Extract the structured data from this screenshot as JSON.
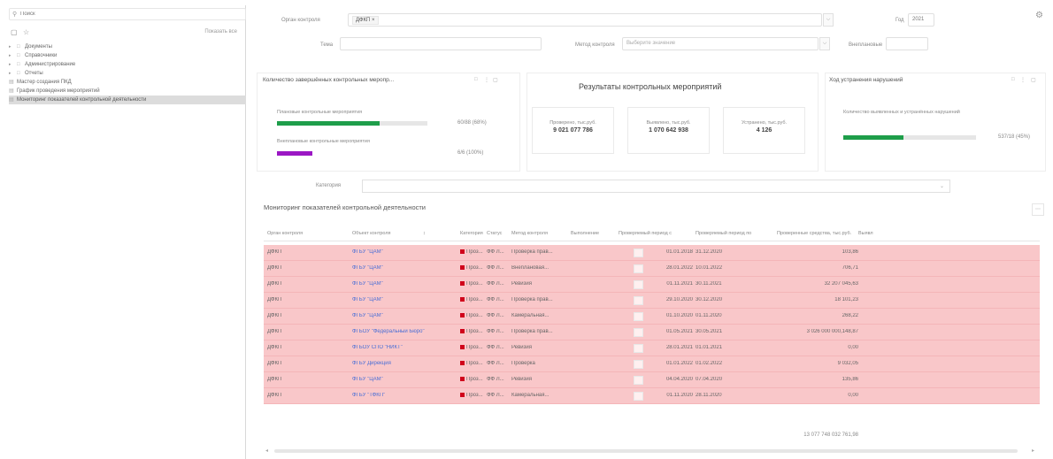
{
  "sidebar": {
    "search_placeholder": "Поиск",
    "show_all": "Показать все",
    "items": [
      {
        "label": "Документы",
        "type": "folder",
        "expandable": true
      },
      {
        "label": "Справочники",
        "type": "folder",
        "expandable": true
      },
      {
        "label": "Администрирование",
        "type": "folder",
        "expandable": true
      },
      {
        "label": "Отчеты",
        "type": "folder",
        "expandable": true
      },
      {
        "label": "Мастер создания ПКД",
        "type": "page",
        "expandable": false
      },
      {
        "label": "График проведения мероприятий",
        "type": "page",
        "expandable": false
      },
      {
        "label": "Мониторинг показателей контрольной деятельности",
        "type": "page",
        "expandable": false,
        "selected": true
      }
    ]
  },
  "filters": {
    "org_label": "Орган контроля",
    "org_value": "ДФКП",
    "year_label": "Год",
    "year_value": "2021",
    "topic_label": "Тема",
    "method_label": "Метод контроля",
    "method_placeholder": "Выберите значение",
    "external_label": "Внеплановые"
  },
  "widget_count": {
    "title": "Количество завершённых контрольных меропр...",
    "planned_label": "Плановые контрольные мероприятия",
    "planned_value": "60/88 (68%)",
    "planned_fraction": 0.68,
    "unplanned_label": "Внеплановые контрольные мероприятия",
    "unplanned_value": "6/6 (100%)",
    "unplanned_fraction": 1.0
  },
  "widget_results": {
    "title": "Результаты контрольных мероприятий",
    "cards": [
      {
        "label": "Проверено, тыс.руб.",
        "value": "9 021 077 786"
      },
      {
        "label": "Выявлено, тыс.руб.",
        "value": "1 070 642 938"
      },
      {
        "label": "Устранено, тыс.руб.",
        "value": "4 126"
      }
    ]
  },
  "widget_violations": {
    "title": "Ход устранения нарушений",
    "label": "Количество выявленных и устранённых нарушений",
    "value": "537/18 (45%)",
    "fraction": 0.45
  },
  "category": {
    "label": "Категория"
  },
  "table": {
    "title": "Мониторинг показателей контрольной деятельности",
    "columns": [
      "Орган контроля",
      "Объект контроля",
      "Категория",
      "Статус",
      "Метод контроля",
      "Выполнение",
      "Проверяемый период с",
      "Проверяемый период по",
      "Проверенные средства, тыс.руб.",
      "Выявл"
    ],
    "rows": [
      {
        "org": "ДФКП",
        "object": "ФГБУ \"ЦАМ\"",
        "category": "Проз...",
        "status": "ФФ Л...",
        "method": "Проверка прав...",
        "from": "01.01.2018",
        "to": "31.12.2020",
        "amount": "103,86"
      },
      {
        "org": "ДФКП",
        "object": "ФГБУ \"ЦАМ\"",
        "category": "Проз...",
        "status": "ФФ Л...",
        "method": "Внеплановая...",
        "from": "28.01.2022",
        "to": "10.01.2022",
        "amount": "706,71"
      },
      {
        "org": "ДФКП",
        "object": "ФГБУ \"ЦАМ\"",
        "category": "Проз...",
        "status": "ФФ Л...",
        "method": "Ревизия",
        "from": "01.11.2021",
        "to": "30.11.2021",
        "amount": "32 207 045,63"
      },
      {
        "org": "ДФКП",
        "object": "ФГБУ \"ЦАМ\"",
        "category": "Проз...",
        "status": "ФФ Л...",
        "method": "Проверка прав...",
        "from": "29.10.2020",
        "to": "30.12.2020",
        "amount": "18 101,23"
      },
      {
        "org": "ДФКП",
        "object": "ФГБУ \"ЦАМ\"",
        "category": "Проз...",
        "status": "ФФ Л...",
        "method": "Камеральная...",
        "from": "01.10.2020",
        "to": "01.11.2020",
        "amount": "268,22"
      },
      {
        "org": "ДФКП",
        "object": "ФГБОУ \"Федеральный Бюро\"",
        "category": "Проз...",
        "status": "ФФ Л...",
        "method": "Проверка прав...",
        "from": "01.05.2021",
        "to": "30.05.2021",
        "amount": "3 026 000 000,148,87"
      },
      {
        "org": "ДФКП",
        "object": "ФГБОУ СПО \"НИКТ\"",
        "category": "Проз...",
        "status": "ФФ Л...",
        "method": "Ревизия",
        "from": "28.01.2021",
        "to": "01.01.2021",
        "amount": "0,00"
      },
      {
        "org": "ДФКП",
        "object": "ФГБУ Дирекция",
        "category": "Проз...",
        "status": "ФФ Л...",
        "method": "Проверка",
        "from": "01.01.2022",
        "to": "01.02.2022",
        "amount": "9 032,05"
      },
      {
        "org": "ДФКП",
        "object": "ФГБУ \"ЦАМ\"",
        "category": "Проз...",
        "status": "ФФ Л...",
        "method": "Ревизия",
        "from": "04.04.2020",
        "to": "07.04.2020",
        "amount": "135,86"
      },
      {
        "org": "ДФКП",
        "object": "ФГБУ \"ТФКП\"",
        "category": "Проз...",
        "status": "ФФ Л...",
        "method": "Камеральная...",
        "from": "01.11.2020",
        "to": "28.11.2020",
        "amount": "0,00"
      }
    ],
    "total": "13 077 748 032 761,98"
  },
  "colors": {
    "row_bg": "#f9c7c9",
    "green_bar": "#1e9e4a",
    "purple_bar": "#9b17c4",
    "category_square": "#d0021b",
    "link": "#4a6fd6"
  }
}
